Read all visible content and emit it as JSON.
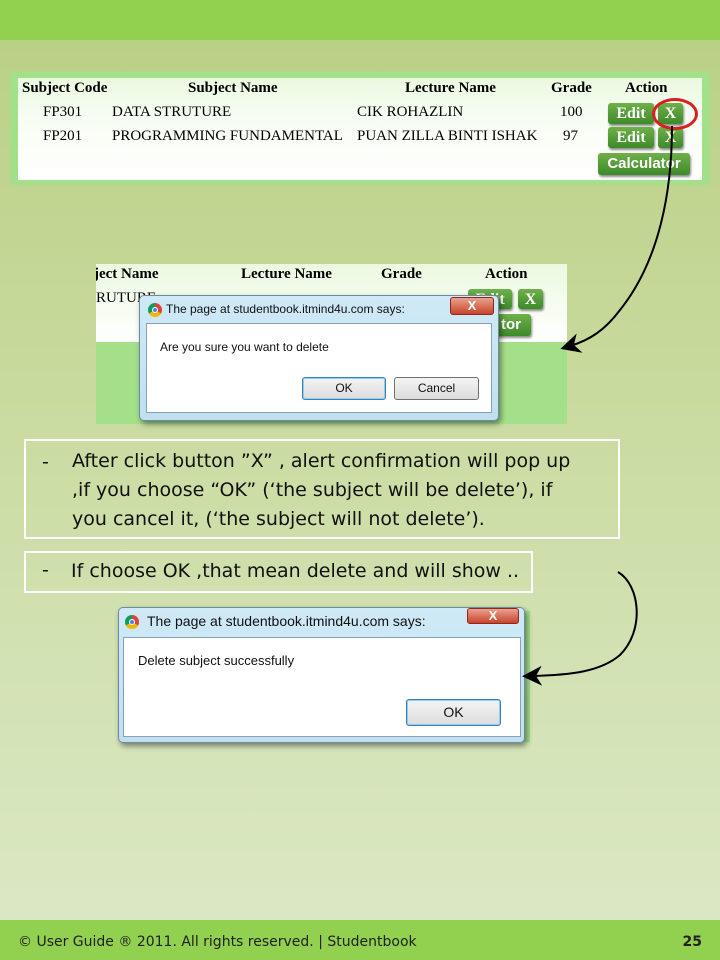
{
  "slide": {
    "footer": "© User Guide ® 2011. All rights reserved. | Studentbook",
    "page_number": "25"
  },
  "table": {
    "headers": [
      "Subject Code",
      "Subject Name",
      "Lecture Name",
      "Grade",
      "Action"
    ],
    "rows": [
      {
        "code": "FP301",
        "name": "DATA STRUTURE",
        "lecturer": "CIK ROHAZLIN",
        "grade": "100"
      },
      {
        "code": "FP201",
        "name": "PROGRAMMING FUNDAMENTAL",
        "lecturer": "PUAN ZILLA BINTI ISHAK",
        "grade": "97"
      }
    ],
    "edit_label": "Edit",
    "delete_label": "X",
    "calculator_label": "Calculator"
  },
  "table_cropped": {
    "headers": [
      "ject Name",
      "Lecture Name",
      "Grade",
      "Action"
    ],
    "row_fragment": "RUTURE",
    "edit_fragment": "Edit",
    "delete_label": "X",
    "calc_fragment": "tor"
  },
  "confirm_dialog": {
    "title": "The page at studentbook.itmind4u.com says:",
    "message": "Are you sure you want to delete",
    "ok_label": "OK",
    "cancel_label": "Cancel",
    "close_label": "X"
  },
  "bullets": {
    "dash": "-",
    "item1": [
      "After click button ”X” , alert confirmation will pop up",
      ",if you choose  “OK”  (‘the subject will be delete’), if",
      "you cancel it, (‘the subject will not delete’)."
    ],
    "item2": "If choose OK ,that mean delete and will show .."
  },
  "success_dialog": {
    "title": "The page at studentbook.itmind4u.com says:",
    "message": "Delete subject successfully",
    "ok_label": "OK",
    "close_label": "X"
  },
  "colors": {
    "bar_green": "#92d050",
    "highlight_red": "#d91f1f"
  }
}
